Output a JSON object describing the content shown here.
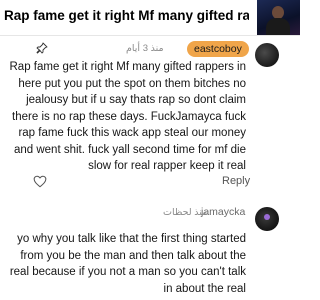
{
  "header": {
    "title": "Rap fame get it right Mf many gifted rap..."
  },
  "comments": [
    {
      "username": "eastcoboy",
      "timestamp": "منذ 3 أيام",
      "text": "Rap fame get it right Mf many gifted rappers in here put you put the spot on them bitches no jealousy but if u say thats rap so dont claim there is no rap these days. FuckJamayca fuck rap fame fuck this wack app steal our money and went shit. fuck yall second time for mf die slow for real rapper keep it real",
      "reply_label": "Reply"
    },
    {
      "username": "jamaycka",
      "timestamp": "منذ لحظات",
      "text": "yo why you talk like that the first thing started from you be the man and then talk about the real because if you not a man so you can't talk in about the real"
    }
  ],
  "colors": {
    "username_chip_bg": "#f0a54a",
    "text": "#161616",
    "muted": "#8a8a8a"
  },
  "icons": [
    "pin-icon",
    "heart-icon"
  ]
}
